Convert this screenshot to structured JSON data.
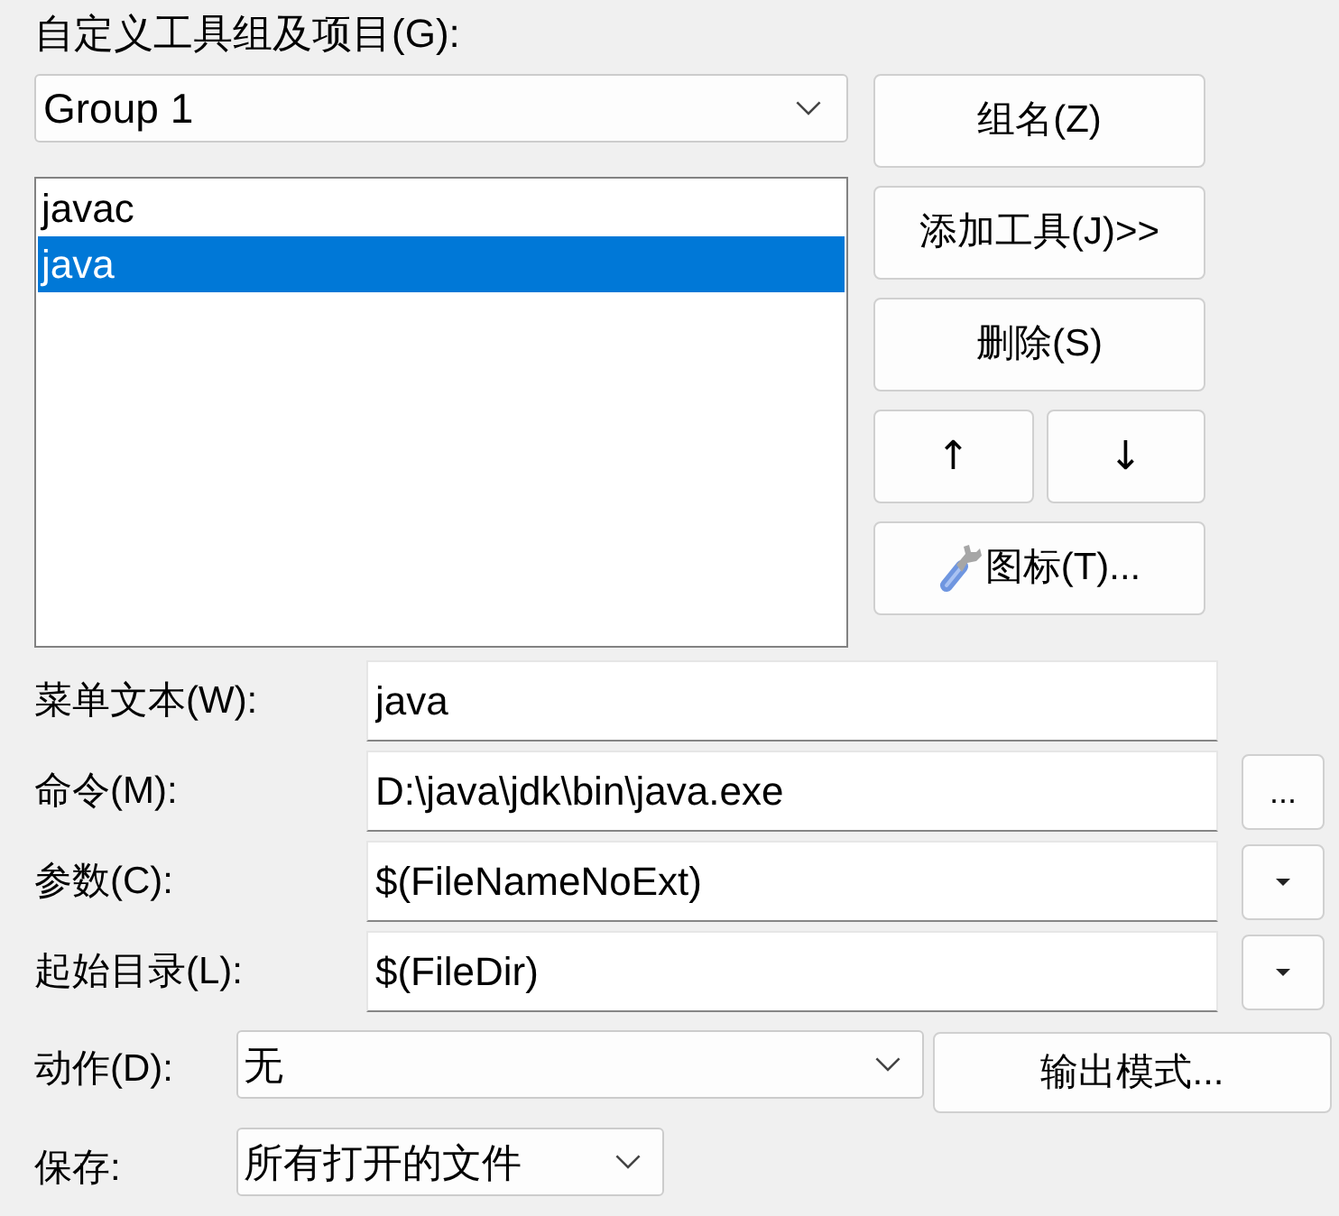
{
  "group_label": "自定义工具组及项目(G):",
  "group_select": {
    "value": "Group 1"
  },
  "tool_list": [
    {
      "label": "javac",
      "selected": false
    },
    {
      "label": "java",
      "selected": true
    }
  ],
  "side_buttons": [
    {
      "kind": "text",
      "label": "组名(Z)"
    },
    {
      "kind": "text",
      "label": "添加工具(J)>>"
    },
    {
      "kind": "text",
      "label": "删除(S)"
    },
    {
      "kind": "pair",
      "labels": [
        "↑",
        "↓"
      ]
    },
    {
      "kind": "icon",
      "label": "图标(T)..."
    }
  ],
  "fields": [
    {
      "kind": "plain",
      "label": "菜单文本(W):",
      "value": "java"
    },
    {
      "kind": "browse",
      "label": "命令(M):",
      "value": "D:\\java\\jdk\\bin\\java.exe",
      "button_label": "..."
    },
    {
      "kind": "menu",
      "label": "参数(C):",
      "value": "$(FileNameNoExt)"
    },
    {
      "kind": "menu",
      "label": "起始目录(L):",
      "value": "$(FileDir)"
    }
  ],
  "action": {
    "label": "动作(D):",
    "value": "无",
    "button_label": "输出模式..."
  },
  "save": {
    "label": "保存:",
    "value": "所有打开的文件"
  }
}
